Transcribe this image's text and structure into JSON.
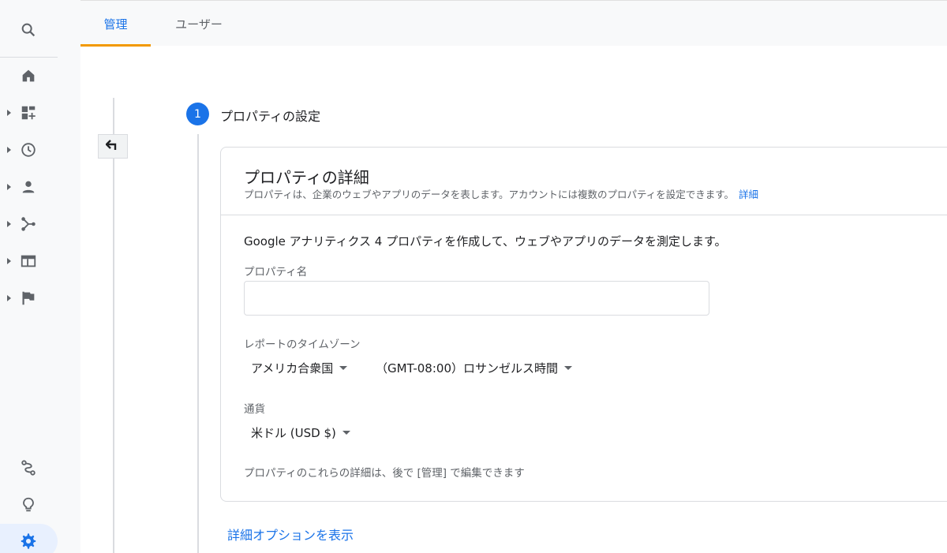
{
  "tabs": [
    {
      "label": "管理",
      "active": true
    },
    {
      "label": "ユーザー",
      "active": false
    }
  ],
  "rail": {
    "items": [
      {
        "icon": "search-icon"
      },
      {
        "icon": "home-icon"
      },
      {
        "icon": "dashboard-icon"
      },
      {
        "icon": "clock-icon"
      },
      {
        "icon": "person-icon"
      },
      {
        "icon": "fork-icon"
      },
      {
        "icon": "window-icon"
      },
      {
        "icon": "flag-icon"
      },
      {
        "icon": "route-icon"
      },
      {
        "icon": "lightbulb-icon"
      },
      {
        "icon": "gear-icon",
        "active": true
      }
    ]
  },
  "step": {
    "number": "1",
    "title": "プロパティの設定"
  },
  "card": {
    "title": "プロパティの詳細",
    "description": "プロパティは、企業のウェブやアプリのデータを表します。アカウントには複数のプロパティを設定できます。",
    "description_link": "詳細",
    "intro": "Google アナリティクス 4 プロパティを作成して、ウェブやアプリのデータを測定します。",
    "property_name_label": "プロパティ名",
    "property_name_value": "",
    "timezone_label": "レポートのタイムゾーン",
    "country_value": "アメリカ合衆国",
    "timezone_value": "（GMT-08:00）ロサンゼルス時間",
    "currency_label": "通貨",
    "currency_value": "米ドル (USD $)",
    "footnote": "プロパティのこれらの詳細は、後で [管理] で編集できます"
  },
  "advanced_link": "詳細オプションを表示",
  "colors": {
    "accent": "#1a73e8",
    "tab_indicator": "#f29900"
  }
}
